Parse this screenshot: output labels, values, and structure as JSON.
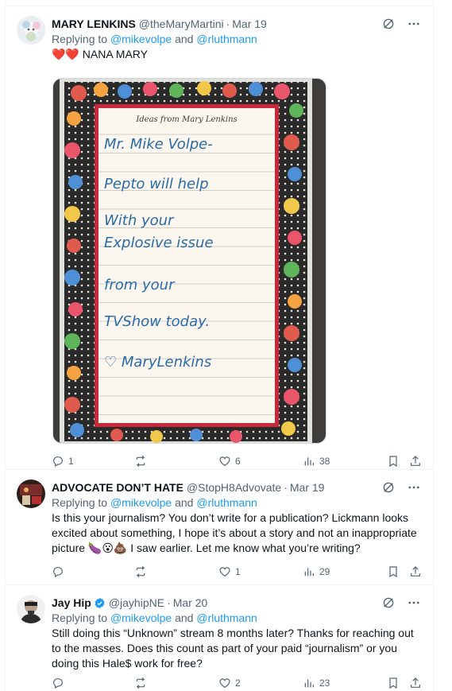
{
  "tweets": [
    {
      "name": "MARY LENKINS",
      "handle": "@theMaryMartini",
      "sep": "·",
      "date": "Mar 19",
      "replying_prefix": "Replying to ",
      "mention1": "@mikevolpe",
      "and": " and ",
      "mention2": "@rluthmann",
      "text_emoji": "❤️❤️",
      "text": " NANA MARY",
      "image": {
        "header": "Ideas from Mary Lenkins",
        "lines": [
          "Mr. Mike Volpe-",
          "Pepto will help",
          "With your",
          "Explosive issue",
          "from your",
          "TVShow today.",
          "♡ MaryLenkins"
        ]
      },
      "stats": {
        "replies": "1",
        "reposts": "",
        "likes": "6",
        "views": "38"
      }
    },
    {
      "name": "ADVOCATE DON’T HATE",
      "handle": "@StopH8Advovate",
      "sep": "·",
      "date": "Mar 19",
      "replying_prefix": "Replying to ",
      "mention1": "@mikevolpe",
      "and": " and ",
      "mention2": "@rluthmann",
      "text": "Is this your journalism? You don’t write for a publication? Lickmann looks excited about something, I hope it’s about a story and not an inappropriate picture 🍆😮💩 I saw earlier. Let me know what you’re writing?",
      "stats": {
        "replies": "",
        "reposts": "",
        "likes": "1",
        "views": "29"
      }
    },
    {
      "name": "Jay Hip",
      "handle": "@jayhipNE",
      "sep": "·",
      "date": "Mar 20",
      "replying_prefix": "Replying to ",
      "mention1": "@mikevolpe",
      "and": " and ",
      "mention2": "@rluthmann",
      "text": "Still doing this “Unknown” stream 8 months later? Thanks for reaching out to the masses. Does this count as part of your paid “journalism” or you doing this Hale$ work for free?",
      "stats": {
        "replies": "",
        "reposts": "",
        "likes": "2",
        "views": "23"
      }
    }
  ],
  "colors": {
    "link": "#1d9bf0",
    "muted": "#536471",
    "text": "#0f1419",
    "verified": "#1d9bf0"
  }
}
